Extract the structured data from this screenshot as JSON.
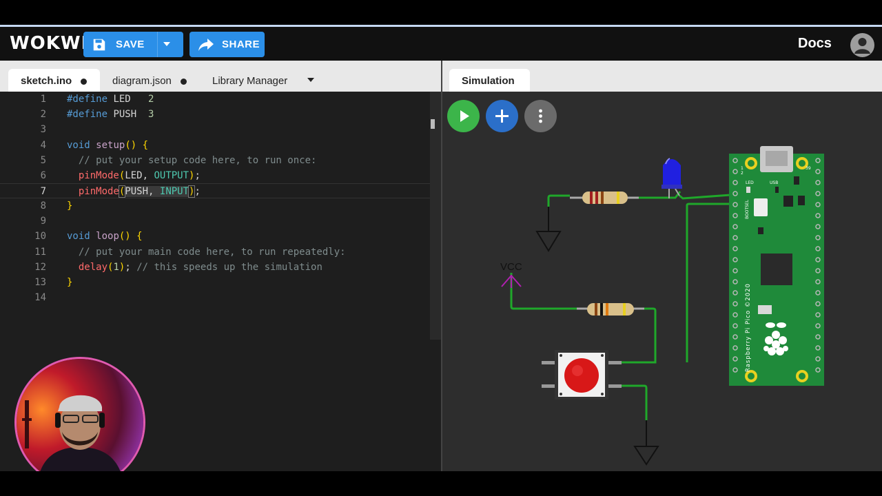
{
  "app": {
    "logo": "WOKWI",
    "save_label": "SAVE",
    "share_label": "SHARE",
    "docs_label": "Docs"
  },
  "editor": {
    "tabs": [
      {
        "label": "sketch.ino",
        "active": true,
        "unsaved": true
      },
      {
        "label": "diagram.json",
        "active": false,
        "unsaved": true
      },
      {
        "label": "Library Manager",
        "active": false,
        "unsaved": false
      }
    ],
    "current_line": 7,
    "lines": [
      {
        "n": "1",
        "text": "#define LED   2"
      },
      {
        "n": "2",
        "text": "#define PUSH  3"
      },
      {
        "n": "3",
        "text": ""
      },
      {
        "n": "4",
        "text": "void setup() {"
      },
      {
        "n": "5",
        "text": "  // put your setup code here, to run once:"
      },
      {
        "n": "6",
        "text": "  pinMode(LED, OUTPUT);"
      },
      {
        "n": "7",
        "text": "  pinMode(PUSH, INPUT);"
      },
      {
        "n": "8",
        "text": "}"
      },
      {
        "n": "9",
        "text": ""
      },
      {
        "n": "10",
        "text": "void loop() {"
      },
      {
        "n": "11",
        "text": "  // put your main code here, to run repeatedly:"
      },
      {
        "n": "12",
        "text": "  delay(1); // this speeds up the simulation"
      },
      {
        "n": "13",
        "text": "}"
      },
      {
        "n": "14",
        "text": ""
      }
    ]
  },
  "simulation": {
    "tab_label": "Simulation",
    "controls": [
      {
        "name": "play",
        "color": "#3cb54a",
        "icon": "play-icon"
      },
      {
        "name": "add-part",
        "color": "#2b6fc9",
        "icon": "plus-icon"
      },
      {
        "name": "more",
        "color": "#6b6b6b",
        "icon": "more-vertical-icon"
      }
    ],
    "vcc_label": "VCC",
    "board": {
      "name": "Raspberry Pi Pico ©2020",
      "led_label": "LED",
      "usb_label": "USB",
      "bootsel_label": "BOOTSEL",
      "pin_1": "2",
      "pin_2": "1",
      "pin_39": "39",
      "color": "#1f8a3a"
    },
    "colors": {
      "wire": "#1fa82a",
      "led": "#2020e0",
      "button_cap": "#d81818",
      "vcc_arrow": "#b020b0"
    }
  },
  "overlay": {
    "webcam": "presenter-webcam"
  }
}
